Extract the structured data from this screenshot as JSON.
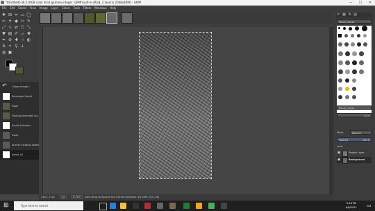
{
  "window": {
    "title": "*[Untitled]-36.0 (RGB color 8-bit gamma integer, GIMP built-in sRGB, 2 layers) 2048x4096 – GIMP",
    "minimize": "—",
    "maximize": "☐",
    "close": "✕"
  },
  "menu": [
    "File",
    "Edit",
    "Select",
    "View",
    "Image",
    "Layer",
    "Colors",
    "Tools",
    "Filters",
    "Windows",
    "Help"
  ],
  "history": {
    "items": [
      {
        "label": "[ Base Image ]"
      },
      {
        "label": "Rectangle Select"
      },
      {
        "label": "Paste"
      },
      {
        "label": "Floating Selection to Layer"
      },
      {
        "label": "Invert Selection"
      },
      {
        "label": "Paste"
      },
      {
        "label": "Anchor Floating Selection"
      },
      {
        "label": "Select All"
      }
    ]
  },
  "status": {
    "coords": "1451, 1722",
    "units": "px",
    "zoom": "6.25%",
    "message": "Click-Drag to replace the current selection (try Shift, Ctrl, Alt)"
  },
  "dock": {
    "filter_placeholder": "Pencil, brush",
    "brush_size": "25.0",
    "mode_label": "Mode",
    "mode_value": "Normal",
    "opacity_label": "Opacity",
    "opacity_value": "100.0",
    "lock_label": "Lock:",
    "layers": [
      {
        "name": "Pasted Layer"
      },
      {
        "name": "Background"
      }
    ]
  },
  "taskbar": {
    "search_placeholder": "Type here to search",
    "time": "5:56 PM",
    "date": "6/6/2021"
  },
  "colors": {
    "accent": "#f3b400",
    "canvas_bg": "#454545"
  }
}
